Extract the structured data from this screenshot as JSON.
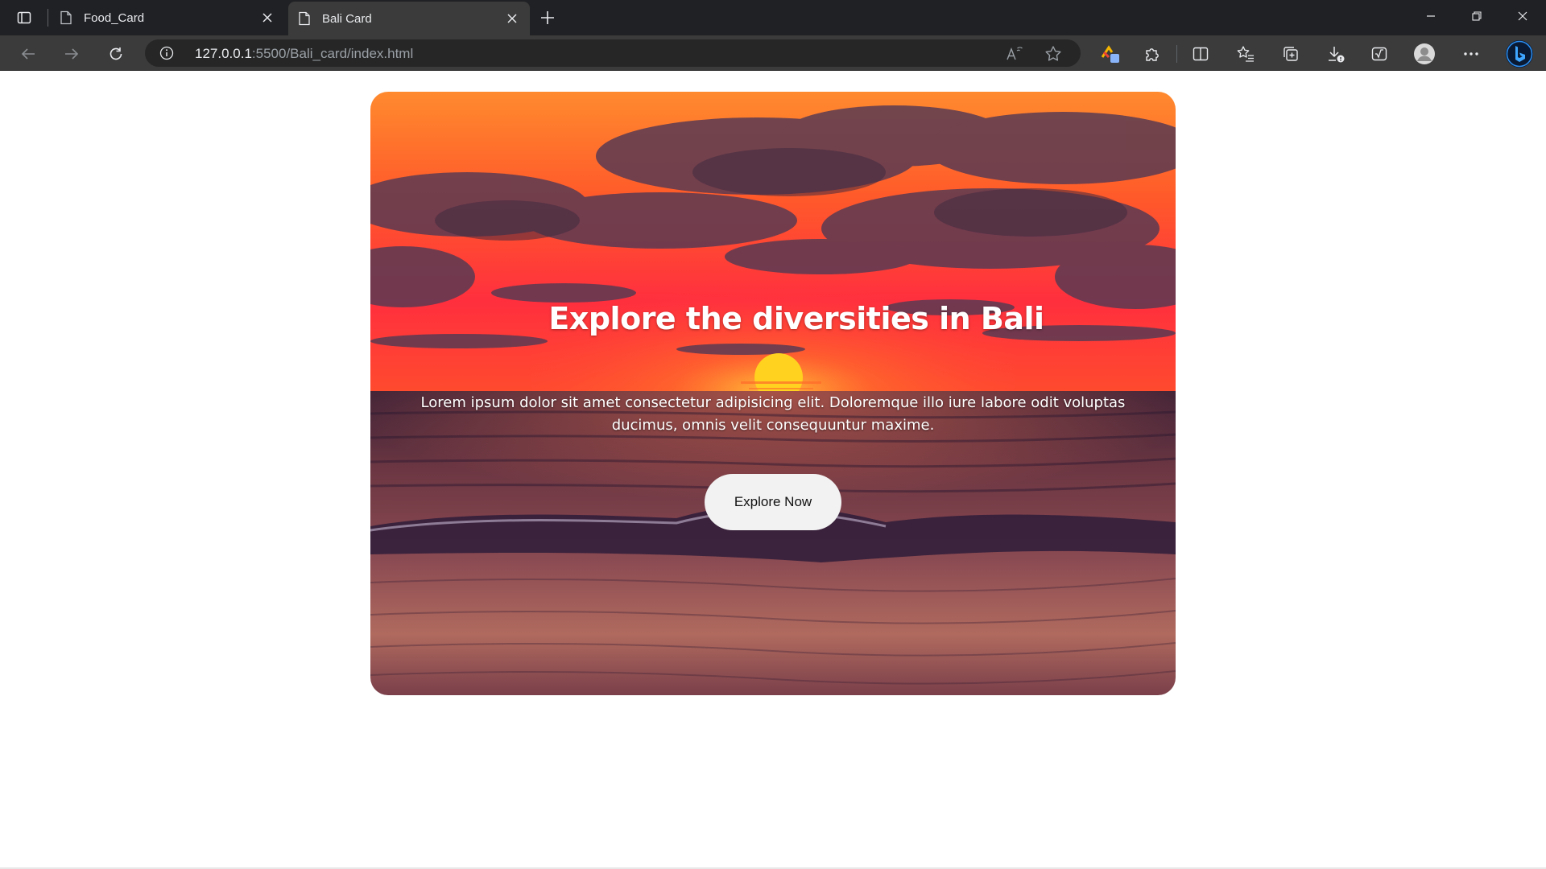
{
  "browser": {
    "tabs": [
      {
        "title": "Food_Card",
        "active": false
      },
      {
        "title": "Bali Card",
        "active": true
      }
    ],
    "address": {
      "host": "127.0.0.1",
      "rest": ":5500/Bali_card/index.html"
    },
    "icons": {
      "tab_actions": "tab-actions-icon",
      "doc": "document-icon",
      "close": "close-icon",
      "new_tab": "plus-icon",
      "back": "back-arrow-icon",
      "forward": "forward-arrow-icon",
      "refresh": "refresh-icon",
      "info": "info-icon",
      "read_aloud": "read-aloud-icon",
      "favorite": "star-icon",
      "extensions": "puzzle-icon",
      "split": "split-screen-icon",
      "favorites": "favorites-list-icon",
      "collections": "collections-icon",
      "downloads": "download-icon",
      "math": "math-solver-icon",
      "profile": "avatar-icon",
      "more": "more-icon",
      "copilot": "bing-icon"
    },
    "colors": {
      "chrome_dark": "#202124",
      "toolbar": "#3b3b3b",
      "omnibox": "#262626"
    }
  },
  "card": {
    "title": "Explore the diversities in Bali",
    "text": "Lorem ipsum dolor sit amet consectetur adipisicing elit. Doloremque illo iure labore odit voluptas ducimus, omnis velit consequuntur maxime.",
    "button_label": "Explore Now",
    "colors": {
      "sky_top": "#ff7a2a",
      "sky_mid": "#ff3b3b",
      "sun": "#ffd21f",
      "sea": "#5a3248",
      "button_bg": "#f2f2f2"
    }
  }
}
